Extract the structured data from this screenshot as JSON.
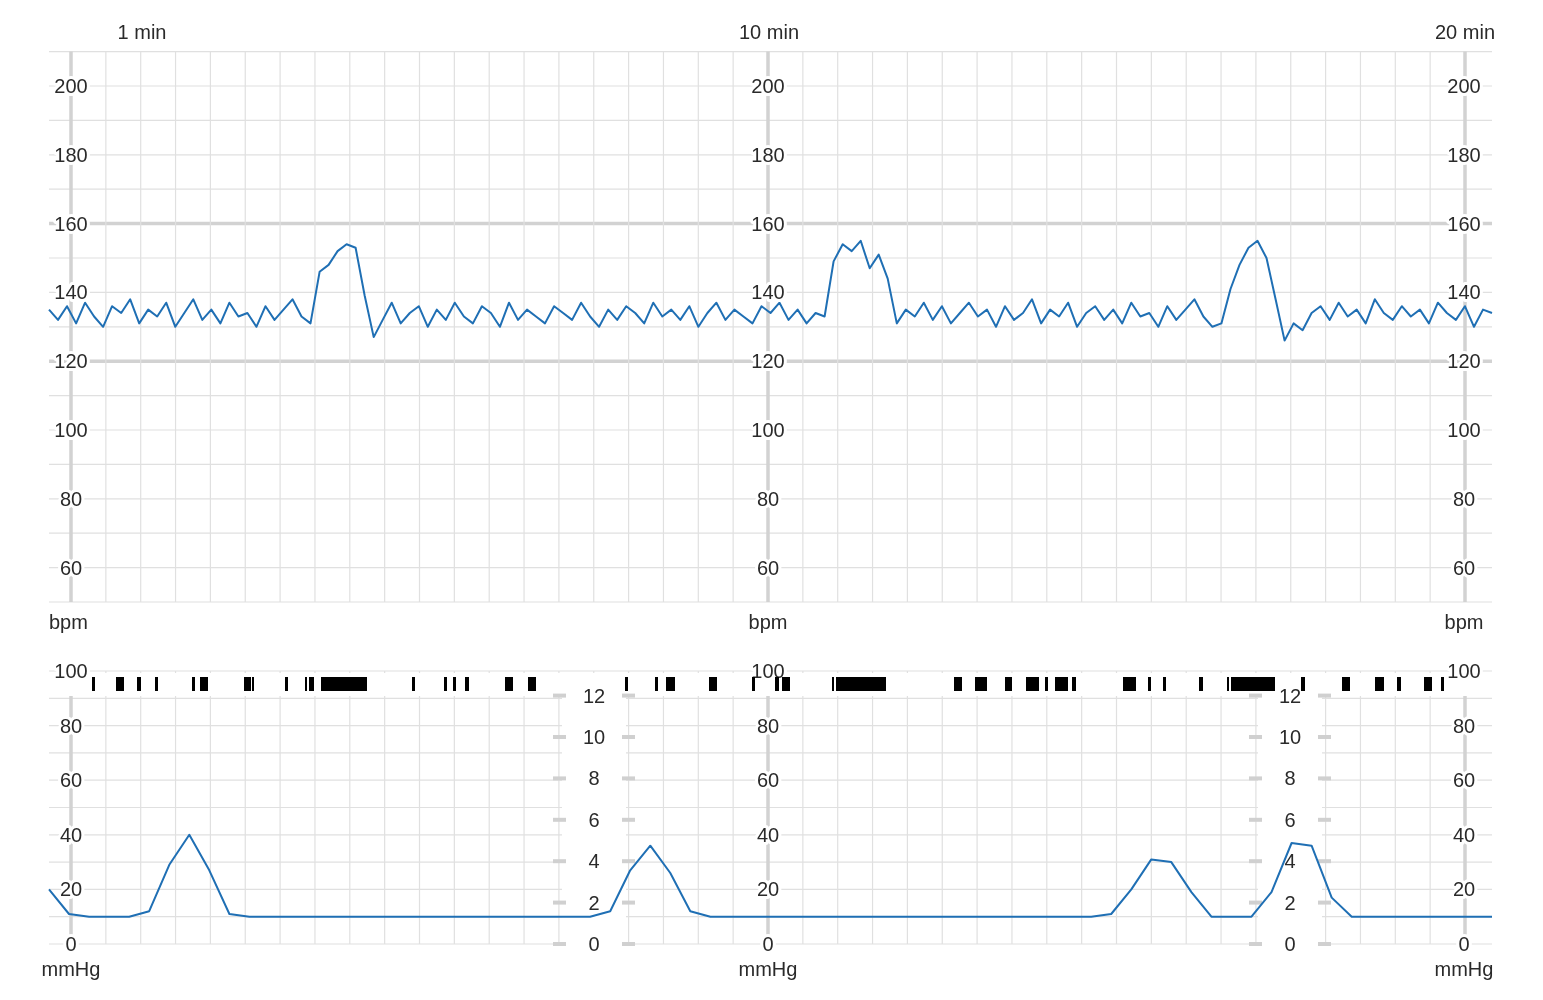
{
  "time_labels": [
    "1 min",
    "10 min",
    "20 min"
  ],
  "heart_rate_chart": {
    "units": [
      "bpm",
      "bpm",
      "bpm"
    ],
    "more_y_axes": [
      {
        "ticks": [
          "200",
          "180",
          "160",
          "140",
          "120",
          "100",
          "80",
          "60"
        ]
      },
      {
        "ticks": [
          "200",
          "180",
          "160",
          "140",
          "120",
          "100",
          "80",
          "60"
        ]
      }
    ],
    "chart_data": {
      "type": "line",
      "grid": true,
      "ylim": [
        50,
        210
      ],
      "yticks": [
        60,
        80,
        100,
        120,
        140,
        160,
        180,
        200
      ],
      "series": [
        {
          "color": "#1f6fb4",
          "values": [
            135,
            132,
            136,
            131,
            137,
            133,
            130,
            136,
            134,
            138,
            131,
            135,
            133,
            137,
            130,
            134,
            138,
            132,
            135,
            131,
            137,
            133,
            134,
            130,
            136,
            132,
            135,
            138,
            133,
            131,
            146,
            148,
            152,
            154,
            153,
            139,
            127,
            132,
            137,
            131,
            134,
            136,
            130,
            135,
            132,
            137,
            133,
            131,
            136,
            134,
            130,
            137,
            132,
            135,
            133,
            131,
            136,
            134,
            132,
            137,
            133,
            130,
            135,
            132,
            136,
            134,
            131,
            137,
            133,
            135,
            132,
            136,
            130,
            134,
            137,
            132,
            135,
            133,
            131,
            136,
            134,
            137,
            132,
            135,
            131,
            134,
            133,
            149,
            154,
            152,
            155,
            147,
            151,
            144,
            131,
            135,
            133,
            137,
            132,
            136,
            131,
            134,
            137,
            133,
            135,
            130,
            136,
            132,
            134,
            138,
            131,
            135,
            133,
            137,
            130,
            134,
            136,
            132,
            135,
            131,
            137,
            133,
            134,
            130,
            136,
            132,
            135,
            138,
            133,
            130,
            131,
            141,
            148,
            153,
            155,
            150,
            138,
            126,
            131,
            129,
            134,
            136,
            132,
            137,
            133,
            135,
            131,
            138,
            134,
            132,
            136,
            133,
            135,
            131,
            137,
            134,
            132,
            136,
            130,
            135,
            134
          ]
        }
      ]
    }
  },
  "contraction_chart": {
    "units": [
      "mmHg",
      "mmHg",
      "mmHg"
    ],
    "more_y_axes": [
      {
        "ticks": [
          "100",
          "80",
          "60",
          "40",
          "20",
          "0"
        ]
      },
      {
        "ticks": [
          "100",
          "80",
          "60",
          "40",
          "20",
          "0"
        ]
      }
    ],
    "secondary_axes": [
      {
        "ticks": [
          "12",
          "10",
          "8",
          "6",
          "4",
          "2",
          "0"
        ]
      },
      {
        "ticks": [
          "12",
          "10",
          "8",
          "6",
          "4",
          "2",
          "0"
        ]
      }
    ],
    "chart_data": {
      "type": "line",
      "grid": true,
      "ylim": [
        0,
        100
      ],
      "yticks": [
        0,
        20,
        40,
        60,
        80,
        100
      ],
      "series": [
        {
          "color": "#1f6fb4",
          "values": [
            20,
            11,
            10,
            10,
            10,
            12,
            29,
            40,
            27,
            11,
            10,
            10,
            10,
            10,
            10,
            10,
            10,
            10,
            10,
            10,
            10,
            10,
            10,
            10,
            10,
            10,
            10,
            10,
            12,
            27,
            36,
            26,
            12,
            10,
            10,
            10,
            10,
            10,
            10,
            10,
            10,
            10,
            10,
            10,
            10,
            10,
            10,
            10,
            10,
            10,
            10,
            10,
            10,
            11,
            20,
            31,
            30,
            19,
            10,
            10,
            10,
            19,
            37,
            36,
            17,
            10,
            10,
            10,
            10,
            10,
            10,
            10,
            10
          ]
        }
      ]
    }
  }
}
